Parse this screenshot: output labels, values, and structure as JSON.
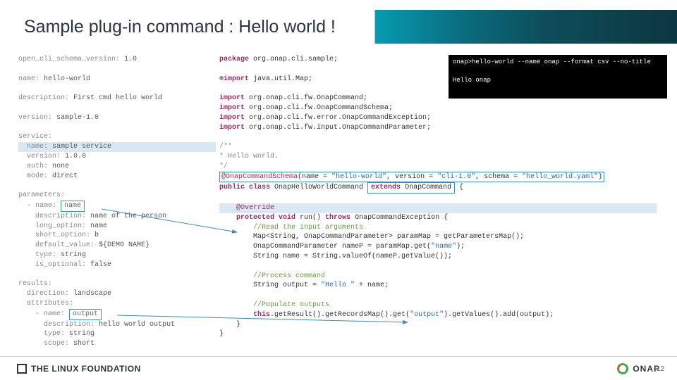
{
  "slide": {
    "title": "Sample plug-in command : Hello world !",
    "page_number": "12"
  },
  "yaml": {
    "schema_key": "open_cli_schema_version:",
    "schema_val": "1.0",
    "name_key": "name:",
    "name_val": "hello-world",
    "desc_key": "description:",
    "desc_val": "First cmd hello world",
    "version_key": "version:",
    "version_val": "sample-1.0",
    "service_key": "service:",
    "svc_name_key": "name:",
    "svc_name_val": "sample service",
    "svc_version_key": "version:",
    "svc_version_val": "1.0.0",
    "svc_auth_key": "auth:",
    "svc_auth_val": "none",
    "svc_mode_key": "mode:",
    "svc_mode_val": "direct",
    "params_key": "parameters:",
    "p_name_key": "- name:",
    "p_name_val": "name",
    "p_desc_key": "description:",
    "p_desc_val": "name of the person",
    "p_long_key": "long_option:",
    "p_long_val": "name",
    "p_short_key": "short_option:",
    "p_short_val": "b",
    "p_def_key": "default_value:",
    "p_def_val": "${DEMO NAME}",
    "p_type_key": "type:",
    "p_type_val": "string",
    "p_opt_key": "is_optional:",
    "p_opt_val": "false",
    "results_key": "results:",
    "r_dir_key": "direction:",
    "r_dir_val": "landscape",
    "r_attr_key": "attributes:",
    "r_name_key": "- name:",
    "r_name_val": "output",
    "r_desc_key": "description:",
    "r_desc_val": "hello world output",
    "r_type_key": "type:",
    "r_type_val": "string",
    "r_scope_key": "scope:",
    "r_scope_val": "short"
  },
  "java": {
    "l1": "package org.onap.cli.sample;",
    "l3": "import java.util.Map;",
    "l5": "import org.onap.cli.fw.OnapCommand;",
    "l6": "import org.onap.cli.fw.OnapCommandSchema;",
    "l7": "import org.onap.cli.fw.error.OnapCommandException;",
    "l8": "import org.onap.cli.fw.input.OnapCommandParameter;",
    "c1": "/**",
    "c2": " * Hello world.",
    "c3": " */",
    "ann_head": "@OnapCommandSchema",
    "ann_body": "(name = \"hello-world\", version = \"cli-1.0\", schema = \"hello_world.yaml\")",
    "cls_pre": "public class OnapHelloWorldCommand ",
    "cls_ext": "extends OnapCommand",
    "cls_brace": " {",
    "ov": "@Override",
    "run": "protected void run() throws OnapCommandException {",
    "rc": "//Read the input arguments",
    "m1": "Map<String, OnapCommandParameter> paramMap = getParametersMap();",
    "m2": "OnapCommandParameter nameP = paramMap.get(\"name\");",
    "m3": "String name = String.valueOf(nameP.getValue());",
    "pc": "//Process command",
    "o1": "String output = \"Hello \" + name;",
    "po": "//Populate outputs",
    "t1": "this.getResult().getRecordsMap().get(\"output\").getValues().add(output);",
    "b1": "}",
    "b2": "}"
  },
  "terminal": {
    "cmd": "onap>hello-world --name onap --format csv --no-title",
    "out": "Hello onap"
  },
  "footer": {
    "lf": "THE LINUX FOUNDATION",
    "onap": "ONAP"
  }
}
